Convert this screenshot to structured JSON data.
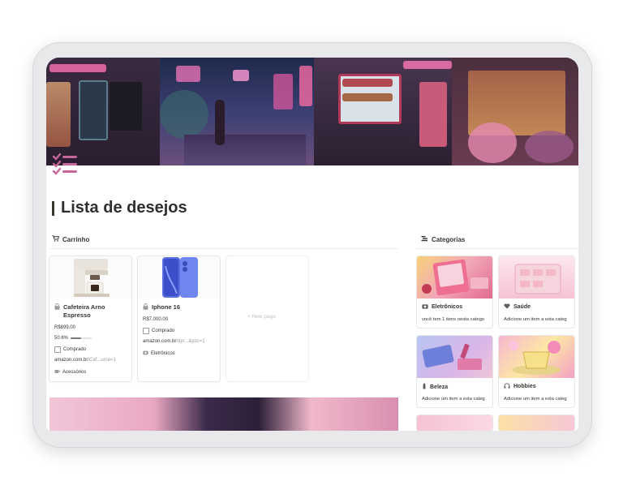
{
  "page": {
    "title": "Lista de desejos"
  },
  "cart": {
    "header": "Carrinho",
    "items": [
      {
        "name": "Cafeteira Arno Espresso",
        "price": "R$899.00",
        "progress_text": "50.6%",
        "progress": 0.506,
        "bought_label": "Comprado",
        "link_main": "amazon.com.br",
        "link_rest": "/Caf...urce=1",
        "category": "Acessórios"
      },
      {
        "name": "Iphone 16",
        "price": "R$7,000.00",
        "bought_label": "Comprado",
        "link_main": "amazon.com.br",
        "link_rest": "/dp/...&psc=1",
        "category": "Eletrônicos"
      }
    ],
    "new_page_label": "+ New page"
  },
  "categories": {
    "header": "Categorias",
    "items": [
      {
        "name": "Eletrônicos",
        "desc": "você tem 1 itens nesta catego",
        "icon": "camera-icon"
      },
      {
        "name": "Saúde",
        "desc": "Adicione um item a esta categ",
        "icon": "heart-pulse-icon"
      },
      {
        "name": "Beleza",
        "desc": "Adicione um item a esta categ",
        "icon": "lipstick-icon"
      },
      {
        "name": "Hobbies",
        "desc": "Adicione um item a esta categ",
        "icon": "headphones-icon"
      }
    ]
  },
  "colors": {
    "accent_pink": "#e8a0bf",
    "icon_pink": "#c6679a"
  }
}
